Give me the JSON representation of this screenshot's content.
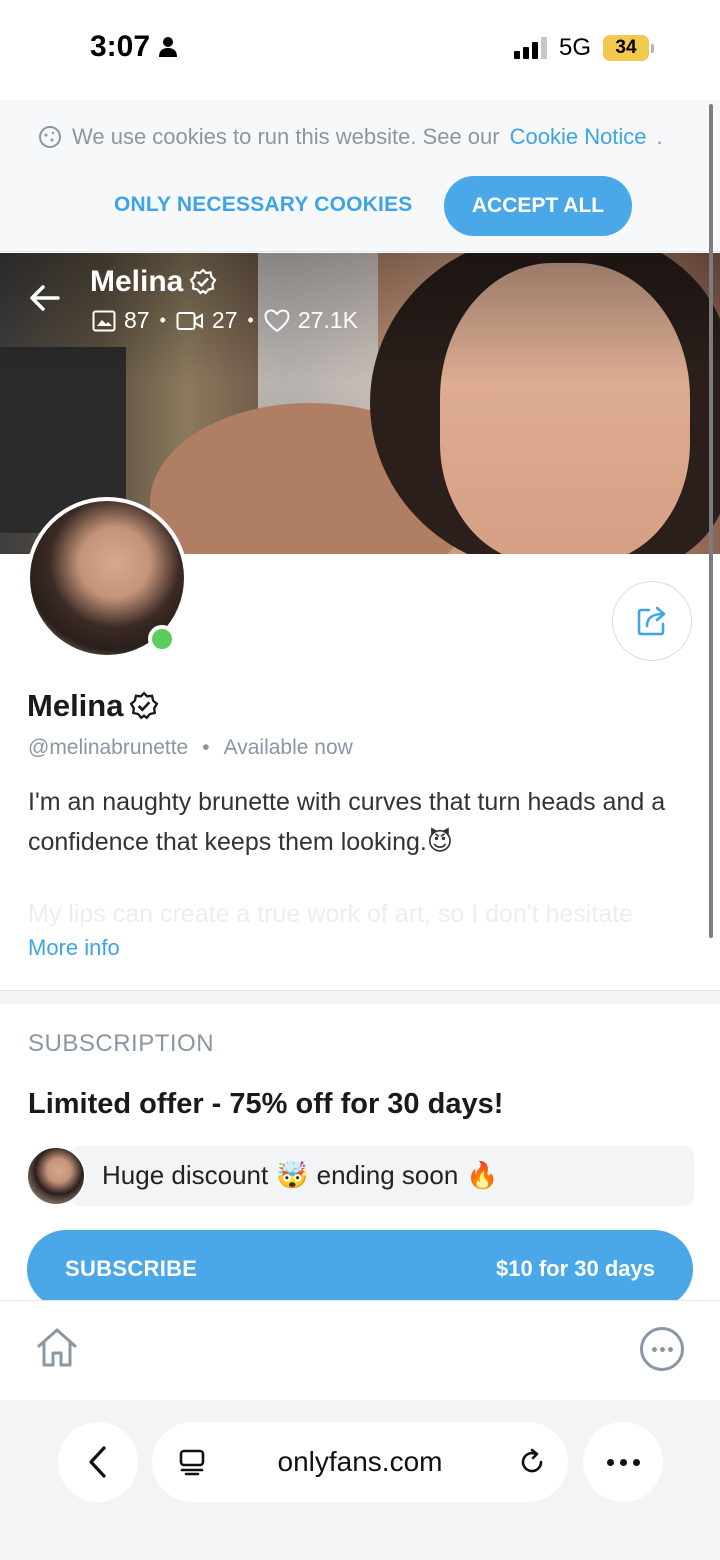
{
  "status_bar": {
    "time": "3:07",
    "network": "5G",
    "battery": "34"
  },
  "cookie_banner": {
    "text": "We use cookies to run this website. See our",
    "link": "Cookie Notice",
    "suffix": ".",
    "necessary_label": "ONLY NECESSARY COOKIES",
    "accept_label": "ACCEPT ALL"
  },
  "cover": {
    "name": "Melina",
    "photos": "87",
    "videos": "27",
    "likes": "27.1K"
  },
  "profile": {
    "name": "Melina",
    "handle": "@melinabrunette",
    "availability": "Available now",
    "bio": "I'm an naughty brunette with curves that turn heads and a confidence that keeps them looking.",
    "bio_emoji": "😈",
    "bio_faded": "My lips can create a true work of art, so I don't hesitate",
    "more_info": "More info"
  },
  "subscription": {
    "heading": "SUBSCRIPTION",
    "offer": "Limited offer - 75% off for 30 days!",
    "discount_text_1": "Huge discount",
    "discount_emoji_1": "🤯",
    "discount_text_2": "ending soon",
    "discount_emoji_2": "🔥",
    "subscribe_label": "SUBSCRIBE",
    "price_label": "$10 for 30 days"
  },
  "browser": {
    "url": "onlyfans.com"
  },
  "colors": {
    "accent": "#4aa8e8",
    "muted": "#8a96a3",
    "online": "#5ccc5a"
  }
}
